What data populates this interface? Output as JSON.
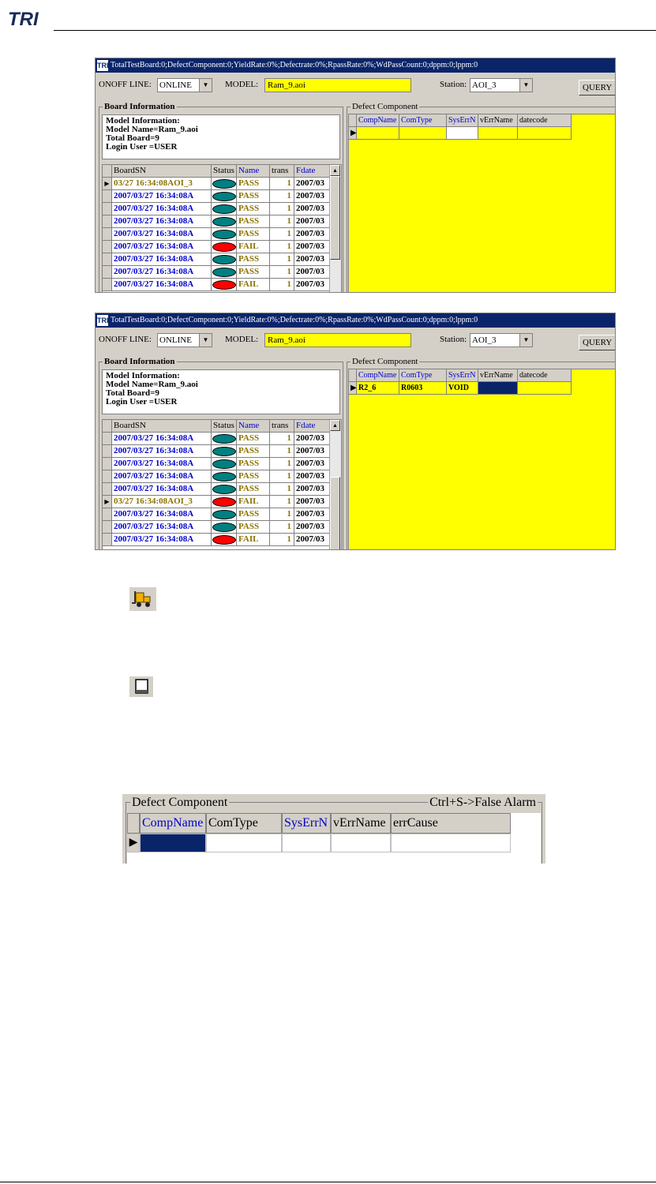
{
  "header": {
    "logo_text": "TRI"
  },
  "windows": [
    {
      "title": "TotalTestBoard:0;DefectComponent:0;YieldRate:0%;Defectrate:0%;RpassRate:0%;WdPassCount:0;dppm:0;lppm:0",
      "onoff_label": "ONOFF LINE:",
      "onoff_value": "ONLINE",
      "model_label": "MODEL:",
      "model_value": "Ram_9.aoi",
      "station_label": "Station:",
      "station_value": "AOI_3",
      "query_label": "QUERY",
      "board_group": "Board Information",
      "info_lines": [
        "Model Information:",
        "Model Name=Ram_9.aoi",
        "Total Board=9",
        "Login User =USER"
      ],
      "board_cols": [
        "BoardSN",
        "Status",
        "Name",
        "trans",
        "Fdate"
      ],
      "board_rows": [
        {
          "sn": "03/27 16:34:08AOI_3",
          "status": "pass",
          "name": "PASS",
          "trans": "1",
          "date": "2007/03",
          "current": true
        },
        {
          "sn": "2007/03/27 16:34:08A",
          "status": "pass",
          "name": "PASS",
          "trans": "1",
          "date": "2007/03"
        },
        {
          "sn": "2007/03/27 16:34:08A",
          "status": "pass",
          "name": "PASS",
          "trans": "1",
          "date": "2007/03"
        },
        {
          "sn": "2007/03/27 16:34:08A",
          "status": "pass",
          "name": "PASS",
          "trans": "1",
          "date": "2007/03"
        },
        {
          "sn": "2007/03/27 16:34:08A",
          "status": "pass",
          "name": "PASS",
          "trans": "1",
          "date": "2007/03"
        },
        {
          "sn": "2007/03/27 16:34:08A",
          "status": "fail",
          "name": "FAIL",
          "trans": "1",
          "date": "2007/03"
        },
        {
          "sn": "2007/03/27 16:34:08A",
          "status": "pass",
          "name": "PASS",
          "trans": "1",
          "date": "2007/03"
        },
        {
          "sn": "2007/03/27 16:34:08A",
          "status": "pass",
          "name": "PASS",
          "trans": "1",
          "date": "2007/03"
        },
        {
          "sn": "2007/03/27 16:34:08A",
          "status": "fail",
          "name": "FAIL",
          "trans": "1",
          "date": "2007/03"
        }
      ],
      "defect_group": "Defect Component",
      "defect_cols": [
        "CompName",
        "ComType",
        "SysErrN",
        "vErrName",
        "datecode"
      ],
      "defect_row": [
        "",
        "",
        "",
        "",
        ""
      ]
    },
    {
      "title": "TotalTestBoard:0;DefectComponent:0;YieldRate:0%;Defectrate:0%;RpassRate:0%;WdPassCount:0;dppm:0;lppm:0",
      "onoff_label": "ONOFF LINE:",
      "onoff_value": "ONLINE",
      "model_label": "MODEL:",
      "model_value": "Ram_9.aoi",
      "station_label": "Station:",
      "station_value": "AOI_3",
      "query_label": "QUERY",
      "board_group": "Board Information",
      "info_lines": [
        "Model Information:",
        "Model Name=Ram_9.aoi",
        "Total Board=9",
        "Login User =USER"
      ],
      "board_cols": [
        "BoardSN",
        "Status",
        "Name",
        "trans",
        "Fdate"
      ],
      "board_rows": [
        {
          "sn": "2007/03/27 16:34:08A",
          "status": "pass",
          "name": "PASS",
          "trans": "1",
          "date": "2007/03"
        },
        {
          "sn": "2007/03/27 16:34:08A",
          "status": "pass",
          "name": "PASS",
          "trans": "1",
          "date": "2007/03"
        },
        {
          "sn": "2007/03/27 16:34:08A",
          "status": "pass",
          "name": "PASS",
          "trans": "1",
          "date": "2007/03"
        },
        {
          "sn": "2007/03/27 16:34:08A",
          "status": "pass",
          "name": "PASS",
          "trans": "1",
          "date": "2007/03"
        },
        {
          "sn": "2007/03/27 16:34:08A",
          "status": "pass",
          "name": "PASS",
          "trans": "1",
          "date": "2007/03"
        },
        {
          "sn": "03/27 16:34:08AOI_3",
          "status": "fail",
          "name": "FAIL",
          "trans": "1",
          "date": "2007/03",
          "current": true
        },
        {
          "sn": "2007/03/27 16:34:08A",
          "status": "pass",
          "name": "PASS",
          "trans": "1",
          "date": "2007/03"
        },
        {
          "sn": "2007/03/27 16:34:08A",
          "status": "pass",
          "name": "PASS",
          "trans": "1",
          "date": "2007/03"
        },
        {
          "sn": "2007/03/27 16:34:08A",
          "status": "fail",
          "name": "FAIL",
          "trans": "1",
          "date": "2007/03"
        }
      ],
      "defect_group": "Defect Component",
      "defect_cols": [
        "CompName",
        "ComType",
        "SysErrN",
        "vErrName",
        "datecode"
      ],
      "defect_row": [
        "R2_6",
        "R0603",
        "VOID",
        "",
        ""
      ]
    }
  ],
  "icons": [
    "forklift-icon",
    "window-icon"
  ],
  "crop": {
    "group": "Defect Component",
    "hint": "Ctrl+S->False Alarm",
    "cols": [
      "CompName",
      "ComType",
      "SysErrN",
      "vErrName",
      "errCause"
    ]
  },
  "colors": {
    "title_bg": "#0a246a",
    "panel_yellow": "#ffff00",
    "pass": "#008080",
    "fail": "#ff0000"
  }
}
